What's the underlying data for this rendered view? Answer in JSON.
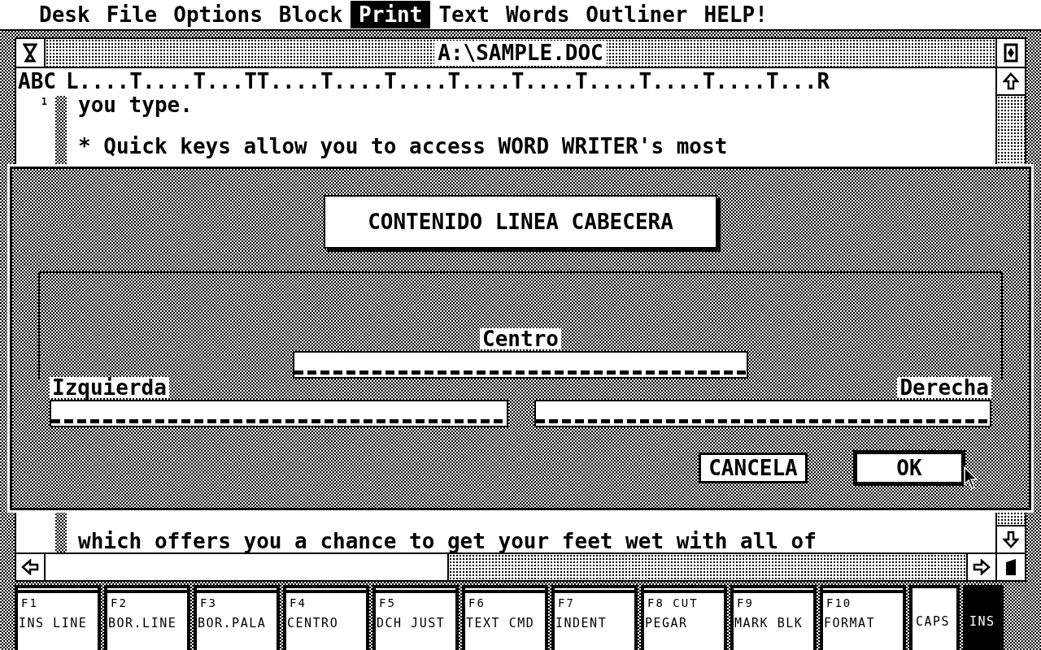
{
  "menu": [
    {
      "label": "Desk",
      "selected": false
    },
    {
      "label": "File",
      "selected": false
    },
    {
      "label": "Options",
      "selected": false
    },
    {
      "label": "Block",
      "selected": false
    },
    {
      "label": "Print",
      "selected": true
    },
    {
      "label": "Text",
      "selected": false
    },
    {
      "label": "Words",
      "selected": false
    },
    {
      "label": "Outliner",
      "selected": false
    },
    {
      "label": "HELP!",
      "selected": false
    }
  ],
  "window": {
    "title": "A:\\SAMPLE.DOC",
    "ruler_label": "ABC",
    "ruler": "L....T....T...TT....T....T....T....T....T....T....T....T...R",
    "line_number": "1",
    "lines": [
      "you type.",
      "* Quick keys allow you to access WORD WRITER's most"
    ],
    "bottom_line": "which offers you a chance to get your feet wet with all of"
  },
  "dialog": {
    "title": "CONTENIDO LINEA CABECERA",
    "fields": [
      {
        "label": "Centro"
      },
      {
        "label": "Izquierda"
      },
      {
        "label": "Derecha"
      }
    ],
    "buttons": [
      {
        "label": "CANCELA",
        "default": false
      },
      {
        "label": "OK",
        "default": true
      }
    ]
  },
  "function_keys": [
    {
      "key": "F1",
      "action": "INS LINE"
    },
    {
      "key": "F2",
      "action": "BOR.LINE"
    },
    {
      "key": "F3",
      "action": "BOR.PALA"
    },
    {
      "key": "F4",
      "action": "CENTRO"
    },
    {
      "key": "F5",
      "action": "DCH JUST"
    },
    {
      "key": "F6",
      "action": "TEXT CMD"
    },
    {
      "key": "F7",
      "action": "INDENT"
    },
    {
      "key": "F8 CUT",
      "action": "PEGAR"
    },
    {
      "key": "F9",
      "action": "MARK BLK"
    },
    {
      "key": "F10",
      "action": "FORMAT"
    }
  ],
  "indicators": [
    {
      "label": "CAPS",
      "on": false
    },
    {
      "label": "INS",
      "on": true
    }
  ]
}
